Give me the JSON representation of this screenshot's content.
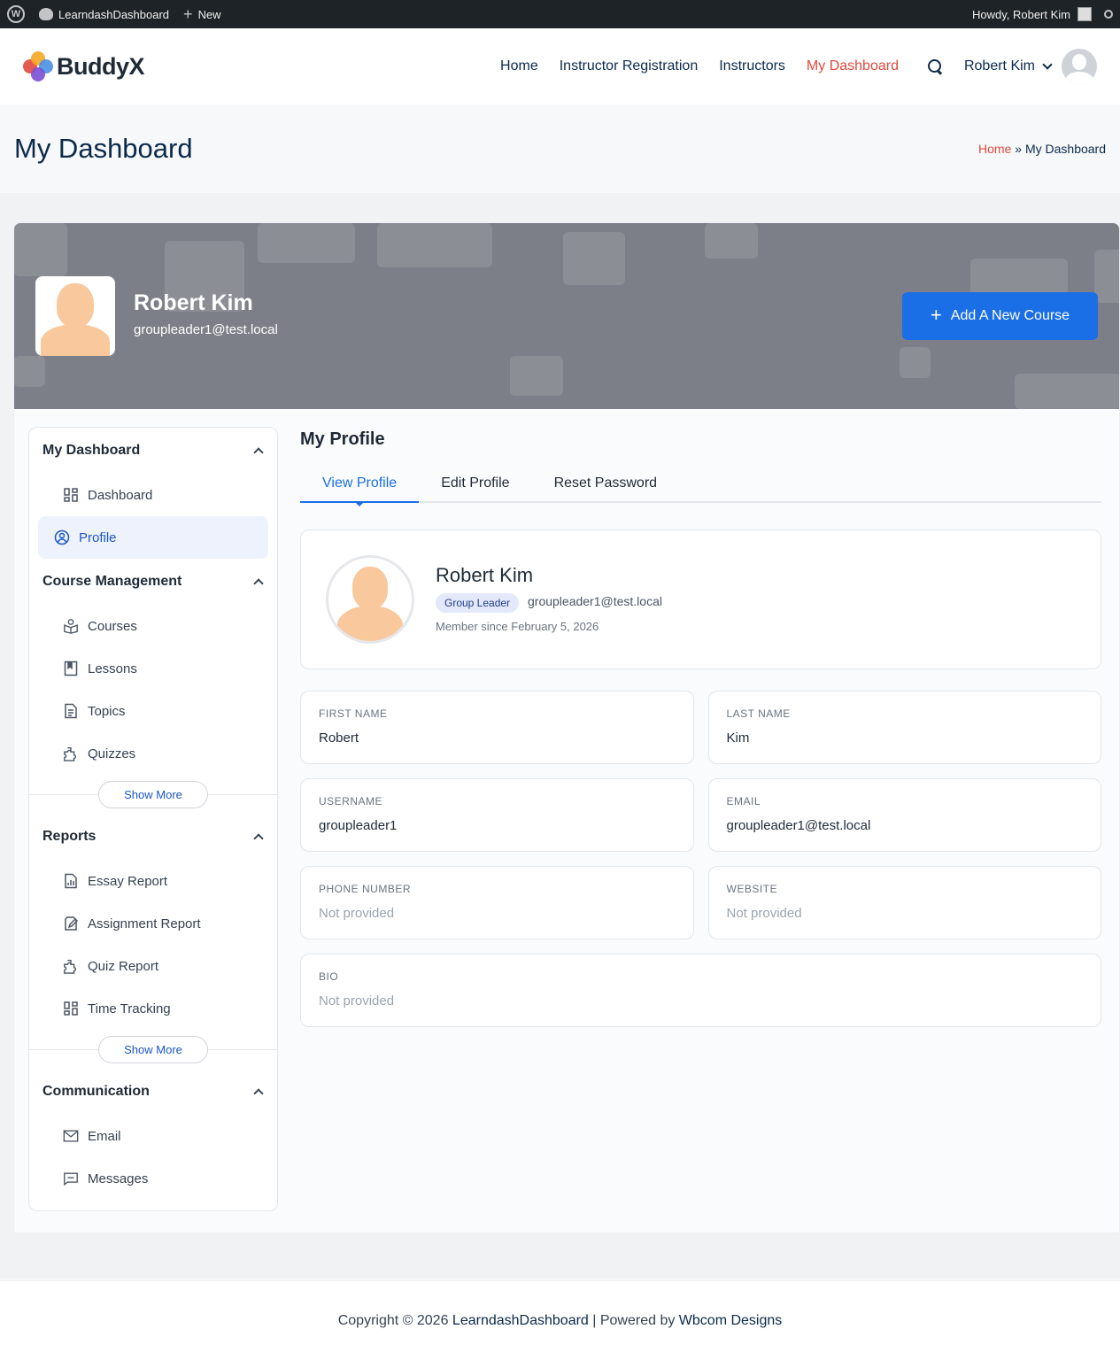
{
  "adminbar": {
    "site_name": "LearndashDashboard",
    "new_label": "New",
    "howdy": "Howdy, Robert Kim"
  },
  "header": {
    "logo_text": "BuddyX",
    "nav": [
      {
        "label": "Home",
        "active": false
      },
      {
        "label": "Instructor Registration",
        "active": false
      },
      {
        "label": "Instructors",
        "active": false
      },
      {
        "label": "My Dashboard",
        "active": true
      }
    ],
    "user_name": "Robert Kim"
  },
  "page": {
    "title": "My Dashboard",
    "breadcrumb": {
      "home": "Home",
      "separator": "»",
      "current": "My Dashboard"
    }
  },
  "banner": {
    "name": "Robert Kim",
    "email": "groupleader1@test.local",
    "add_course_label": "Add A New Course"
  },
  "sidebar": {
    "sections": [
      {
        "title": "My Dashboard",
        "items": [
          {
            "label": "Dashboard",
            "icon": "grid-icon"
          },
          {
            "label": "Profile",
            "icon": "user-circle-icon",
            "active": true
          }
        ]
      },
      {
        "title": "Course Management",
        "items": [
          {
            "label": "Courses",
            "icon": "book-open-icon"
          },
          {
            "label": "Lessons",
            "icon": "bookmark-icon"
          },
          {
            "label": "Topics",
            "icon": "document-icon"
          },
          {
            "label": "Quizzes",
            "icon": "puzzle-icon"
          }
        ],
        "show_more": "Show More"
      },
      {
        "title": "Reports",
        "items": [
          {
            "label": "Essay Report",
            "icon": "chart-icon"
          },
          {
            "label": "Assignment Report",
            "icon": "edit-icon"
          },
          {
            "label": "Quiz Report",
            "icon": "puzzle-icon"
          },
          {
            "label": "Time Tracking",
            "icon": "grid-icon"
          }
        ],
        "show_more": "Show More"
      },
      {
        "title": "Communication",
        "items": [
          {
            "label": "Email",
            "icon": "mail-icon"
          },
          {
            "label": "Messages",
            "icon": "message-icon"
          }
        ]
      }
    ]
  },
  "main": {
    "title": "My Profile",
    "tabs": [
      {
        "label": "View Profile",
        "active": true
      },
      {
        "label": "Edit Profile"
      },
      {
        "label": "Reset Password"
      }
    ],
    "profile": {
      "name": "Robert Kim",
      "role": "Group Leader",
      "email": "groupleader1@test.local",
      "member_since": "Member since February 5, 2026"
    },
    "fields": {
      "first_name": {
        "label": "FIRST NAME",
        "value": "Robert"
      },
      "last_name": {
        "label": "LAST NAME",
        "value": "Kim"
      },
      "username": {
        "label": "USERNAME",
        "value": "groupleader1"
      },
      "email": {
        "label": "EMAIL",
        "value": "groupleader1@test.local"
      },
      "phone": {
        "label": "PHONE NUMBER",
        "value": "Not provided"
      },
      "website": {
        "label": "WEBSITE",
        "value": "Not provided"
      },
      "bio": {
        "label": "BIO",
        "value": "Not provided"
      }
    }
  },
  "footer": {
    "prefix": "Copyright © 2026 ",
    "site_link": "LearndashDashboard",
    "middle": " | Powered by ",
    "powered_link": "Wbcom Designs"
  },
  "colors": {
    "accent": "#1a6ee6",
    "active_nav": "#e2483d",
    "admin_bar": "#1d2327",
    "banner": "#7d7f88"
  }
}
